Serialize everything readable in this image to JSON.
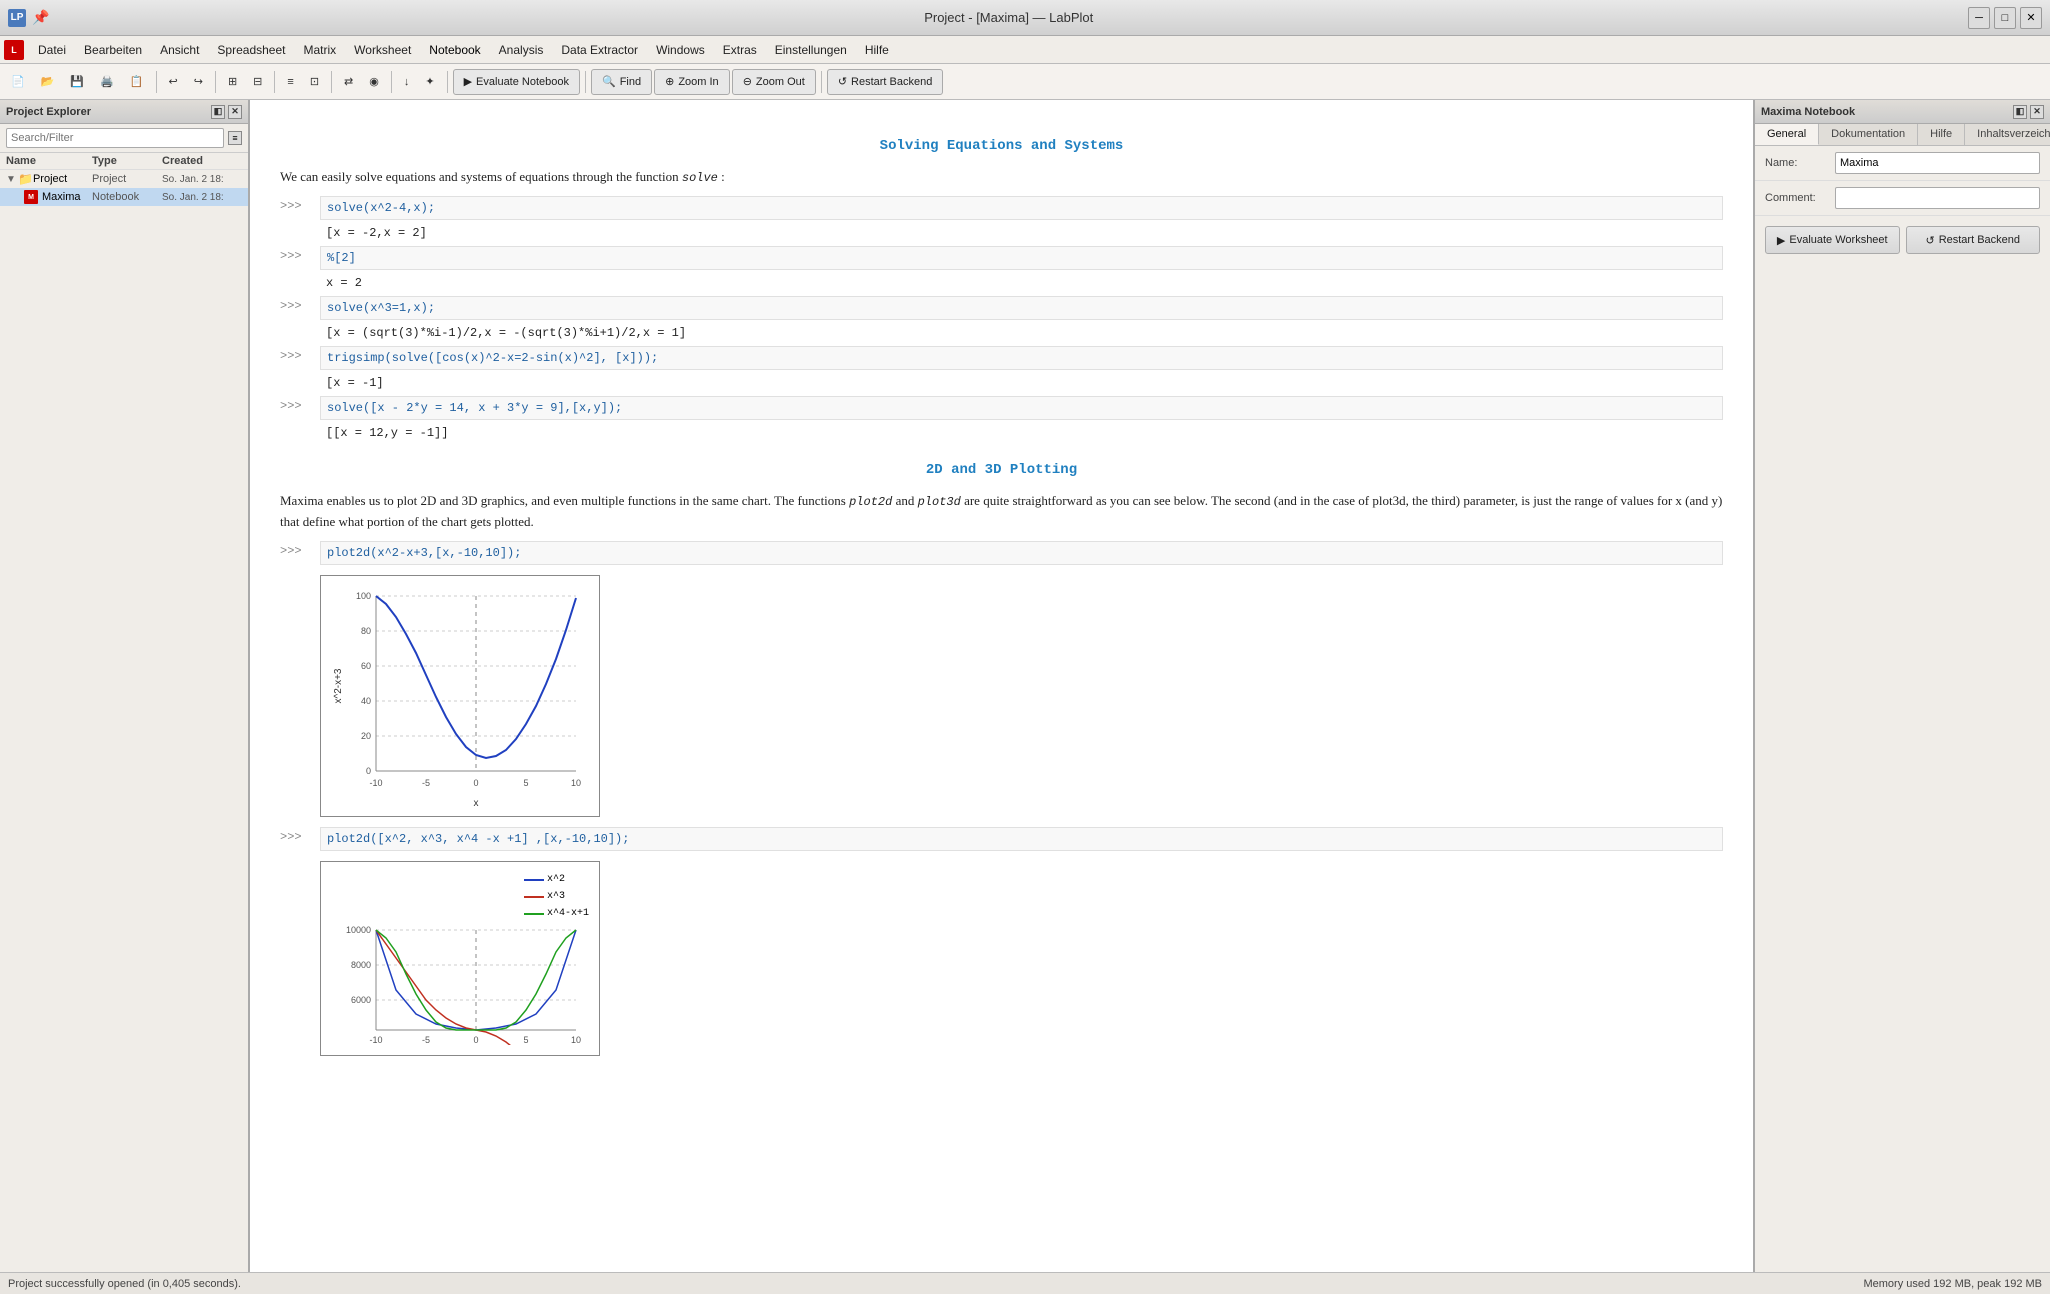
{
  "window": {
    "title": "Project - [Maxima] — LabPlot",
    "icon_label": "LP"
  },
  "titlebar": {
    "controls": [
      "─",
      "□",
      "✕"
    ],
    "pin_icon": "📌"
  },
  "menubar": {
    "logo": "L",
    "items": [
      {
        "label": "Datei",
        "id": "datei"
      },
      {
        "label": "Bearbeiten",
        "id": "bearbeiten"
      },
      {
        "label": "Ansicht",
        "id": "ansicht"
      },
      {
        "label": "Spreadsheet",
        "id": "spreadsheet"
      },
      {
        "label": "Matrix",
        "id": "matrix"
      },
      {
        "label": "Worksheet",
        "id": "worksheet"
      },
      {
        "label": "Notebook",
        "id": "notebook",
        "active": true
      },
      {
        "label": "Analysis",
        "id": "analysis"
      },
      {
        "label": "Data Extractor",
        "id": "data-extractor"
      },
      {
        "label": "Windows",
        "id": "windows"
      },
      {
        "label": "Extras",
        "id": "extras"
      },
      {
        "label": "Einstellungen",
        "id": "einstellungen"
      },
      {
        "label": "Hilfe",
        "id": "hilfe"
      }
    ]
  },
  "toolbar": {
    "buttons": [
      {
        "icon": "📄",
        "title": "New"
      },
      {
        "icon": "📂",
        "title": "Open"
      },
      {
        "icon": "💾",
        "title": "Save"
      },
      {
        "icon": "🖨️",
        "title": "Print"
      },
      {
        "icon": "📋",
        "title": "Copy"
      },
      {
        "sep": true
      },
      {
        "icon": "↩",
        "title": "Undo"
      },
      {
        "icon": "↪",
        "title": "Redo"
      },
      {
        "sep": true
      },
      {
        "icon": "⊞",
        "title": "View1"
      },
      {
        "icon": "⊟",
        "title": "View2"
      },
      {
        "sep": true
      },
      {
        "icon": "📊",
        "title": "Chart1"
      },
      {
        "icon": "📈",
        "title": "Chart2"
      },
      {
        "sep": true
      },
      {
        "icon": "⇄",
        "title": "Exchange"
      },
      {
        "icon": "◉",
        "title": "Circle"
      },
      {
        "sep": true
      },
      {
        "icon": "↓",
        "title": "Down"
      },
      {
        "icon": "⬡",
        "title": "Hex"
      },
      {
        "sep": true
      }
    ],
    "text_buttons": [
      {
        "label": "Evaluate Notebook",
        "icon": "▶",
        "id": "evaluate-notebook"
      },
      {
        "label": "Find",
        "icon": "🔍",
        "id": "find"
      },
      {
        "label": "Zoom In",
        "icon": "🔍+",
        "id": "zoom-in"
      },
      {
        "label": "Zoom Out",
        "icon": "🔍-",
        "id": "zoom-out"
      },
      {
        "label": "Restart Backend",
        "icon": "↺",
        "id": "restart-backend"
      }
    ]
  },
  "project_explorer": {
    "title": "Project Explorer",
    "search_placeholder": "Search/Filter",
    "columns": [
      "Name",
      "Type",
      "Created"
    ],
    "items": [
      {
        "level": 0,
        "name": "Project",
        "type": "Project",
        "created": "So. Jan. 2 18:",
        "icon": "folder",
        "expanded": true
      },
      {
        "level": 1,
        "name": "Maxima",
        "type": "Notebook",
        "created": "So. Jan. 2 18:",
        "icon": "notebook",
        "selected": true
      }
    ]
  },
  "notebook": {
    "sections": [
      {
        "type": "title",
        "text": "Solving Equations and Systems"
      },
      {
        "type": "prose",
        "text": "We can easily solve equations and systems of equations through the function solve :"
      },
      {
        "type": "input",
        "prompt": ">>>",
        "code": "solve(x^2-4,x);"
      },
      {
        "type": "output",
        "text": "[x = -2,x = 2]"
      },
      {
        "type": "input",
        "prompt": ">>>",
        "code": "%[2]"
      },
      {
        "type": "output",
        "text": "x = 2"
      },
      {
        "type": "input",
        "prompt": ">>>",
        "code": "solve(x^3=1,x);"
      },
      {
        "type": "output",
        "text": "[x = (sqrt(3)*%i-1)/2,x = -(sqrt(3)*%i+1)/2,x = 1]"
      },
      {
        "type": "input",
        "prompt": ">>>",
        "code": "trigsimp(solve([cos(x)^2-x=2-sin(x)^2], [x]));"
      },
      {
        "type": "output",
        "text": "[x = -1]"
      },
      {
        "type": "input",
        "prompt": ">>>",
        "code": "solve([x - 2*y = 14,  x + 3*y = 9],[x,y]);"
      },
      {
        "type": "output",
        "text": "[[x = 12,y = -1]]"
      },
      {
        "type": "title",
        "text": "2D and 3D Plotting"
      },
      {
        "type": "prose",
        "text": "Maxima enables us to plot 2D and 3D graphics, and even multiple functions in the same chart. The functions plot2d and plot3d are quite straightforward as you can see below. The second (and in the case of plot3d, the third) parameter, is just the range of values for x (and y) that define what portion of the chart gets plotted."
      },
      {
        "type": "input",
        "prompt": ">>>",
        "code": "plot2d(x^2-x+3,[x,-10,10]);"
      },
      {
        "type": "chart1",
        "y_label": "x^2-x+3",
        "x_label": "x",
        "y_ticks": [
          "100",
          "80",
          "60",
          "40",
          "20",
          "0"
        ],
        "x_ticks": [
          "-10",
          "-5",
          "0",
          "5",
          "10"
        ]
      },
      {
        "type": "input",
        "prompt": ">>>",
        "code": "plot2d([x^2, x^3, x^4 -x +1] ,[x,-10,10]);"
      },
      {
        "type": "chart2",
        "legend": [
          {
            "label": "x^2",
            "color": "#2040c0"
          },
          {
            "label": "x^3",
            "color": "#c03020"
          },
          {
            "label": "x^4-x+1",
            "color": "#20a020"
          }
        ],
        "y_ticks": [
          "10000",
          "8000",
          "6000"
        ],
        "x_ticks": [
          "-10",
          "-5",
          "0",
          "5",
          "10"
        ]
      }
    ]
  },
  "maxima_notebook_panel": {
    "title": "Maxima Notebook",
    "tabs": [
      {
        "label": "General",
        "active": true
      },
      {
        "label": "Dokumentation"
      },
      {
        "label": "Hilfe"
      },
      {
        "label": "Inhaltsverzeichn..."
      }
    ],
    "fields": [
      {
        "label": "Name:",
        "value": "Maxima",
        "id": "name-field"
      },
      {
        "label": "Comment:",
        "value": "",
        "id": "comment-field"
      }
    ],
    "buttons": [
      {
        "label": "Evaluate Worksheet",
        "icon": "▶",
        "id": "evaluate-worksheet-btn"
      },
      {
        "label": "Restart Backend",
        "icon": "↺",
        "id": "restart-backend-btn"
      }
    ]
  },
  "statusbar": {
    "left": "Project successfully opened (in 0,405 seconds).",
    "right": "Memory used 192 MB, peak 192 MB"
  }
}
